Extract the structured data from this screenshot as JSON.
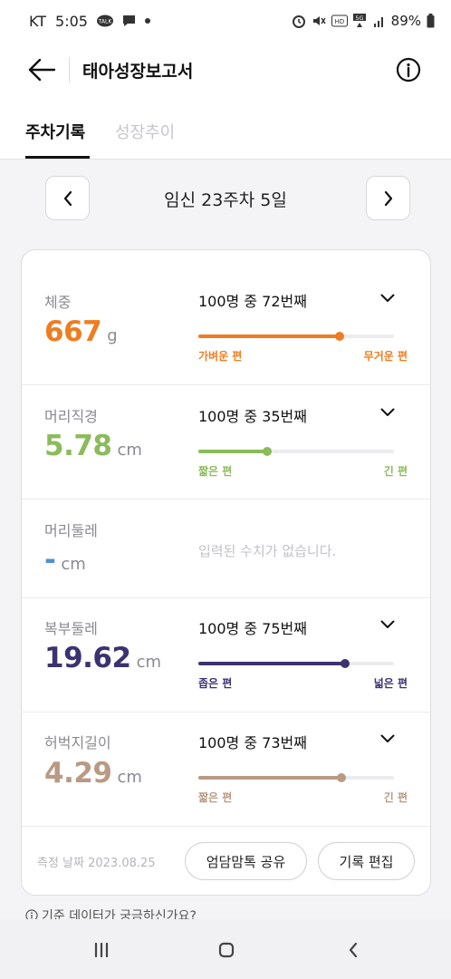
{
  "status_bar": {
    "carrier": "KT",
    "time": "5:05",
    "notification_icons": [
      "talk-icon",
      "chat-icon",
      "dot-icon"
    ],
    "battery": "89%"
  },
  "app_bar": {
    "title": "태아성장보고서"
  },
  "tabs": [
    {
      "label": "주차기록",
      "active": true
    },
    {
      "label": "성장추이",
      "active": false
    }
  ],
  "week_nav": {
    "title": "임신 23주차 5일"
  },
  "measurements": [
    {
      "label": "체중",
      "value": "667",
      "unit": "g",
      "rank": "100명 중 72번째",
      "percent": 72,
      "low_label": "가벼운 편",
      "high_label": "무거운 편",
      "color": "#ee7d22"
    },
    {
      "label": "머리직경",
      "value": "5.78",
      "unit": "cm",
      "rank": "100명 중 35번째",
      "percent": 35,
      "low_label": "짧은 편",
      "high_label": "긴 편",
      "color": "#8bbb5a"
    },
    {
      "label": "머리둘레",
      "value": "-",
      "unit": "cm",
      "empty_message": "입력된 수치가 없습니다.",
      "color": "#4f8fd4"
    },
    {
      "label": "복부둘레",
      "value": "19.62",
      "unit": "cm",
      "rank": "100명 중 75번째",
      "percent": 75,
      "low_label": "좁은 편",
      "high_label": "넓은 편",
      "color": "#3b3370"
    },
    {
      "label": "허벅지길이",
      "value": "4.29",
      "unit": "cm",
      "rank": "100명 중 73번째",
      "percent": 73,
      "low_label": "짧은 편",
      "high_label": "긴 편",
      "color": "#b99a84"
    }
  ],
  "footer": {
    "measure_date": "측정 날짜 2023.08.25",
    "share_button": "엄담맘톡 공유",
    "edit_button": "기록 편집"
  },
  "hint_text": "기준 데이터가 궁금하신가요?"
}
